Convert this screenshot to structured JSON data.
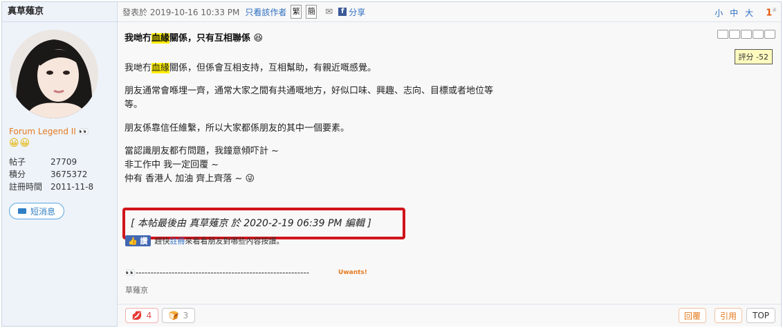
{
  "author": {
    "name": "真草薙京",
    "rank": "Forum Legend II",
    "smileys": "😀😀",
    "stats": [
      {
        "label": "帖子",
        "value": "27709"
      },
      {
        "label": "積分",
        "value": "3675372"
      },
      {
        "label": "註冊時間",
        "value": "2011-11-8"
      }
    ],
    "pm_label": "短消息"
  },
  "post_header": {
    "posted_text": "發表於 2019-10-16 10:33 PM",
    "author_only": "只看該作者",
    "trad": "繁",
    "simp": "簡",
    "share": "分享",
    "font_small": "小",
    "font_mid": "中",
    "font_large": "大",
    "floor": "1",
    "floor_sup": "#"
  },
  "post": {
    "title_pre": "我哋冇",
    "title_hl": "血緣",
    "title_post": "關係，只有互相聯係 😆",
    "rating": "評分 -52",
    "p1_pre": "我哋冇",
    "p1_hl": "血緣",
    "p1_post": "關係，但係會互相支持，互相幫助，有親近嘅感覺。",
    "p2_line1": "朋友通常會喺埋一齊，通常大家之間有共通嘅地方，好似口味、興趣、志向、目標或者地位等",
    "p2_line2": "等。",
    "p3": "朋友係靠信任維繫，所以大家都係朋友的其中一個要素。",
    "p4_line1": "當認識朋友都冇問題，我鐘意傾吓計 ~",
    "p4_line2": "非工作中 我一定回覆 ~",
    "p4_line3": "仲有 香港人 加油 齊上齊落 ~ 😜",
    "edit_note": "[ 本帖最後由 真草薙京 於 2020-2-19 06:39 PM 編輯 ]",
    "like_label": "👍 讚",
    "like_pre": "趕快",
    "like_link": "註冊",
    "like_post": "來看看朋友對哪些內容按讚。"
  },
  "signature": {
    "line": "👀----------------------------------------------------------",
    "uwants": "Uwants!",
    "name": "草薙京"
  },
  "footer": {
    "kiss_count": "4",
    "bread_count": "3",
    "reply": "回覆",
    "quote": "引用",
    "top": "TOP"
  }
}
